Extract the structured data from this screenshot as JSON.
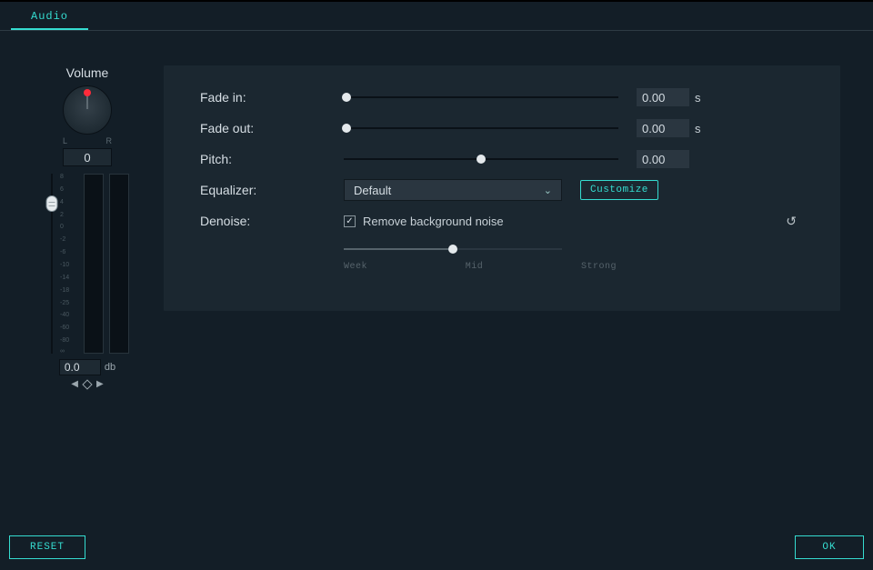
{
  "tab": {
    "audio": "Audio"
  },
  "volume": {
    "title": "Volume",
    "left": "L",
    "right": "R",
    "pan": "0",
    "db_value": "0.0",
    "db_unit": "db",
    "scale": [
      "8",
      "6",
      "4",
      "2",
      "0",
      "-2",
      "-6",
      "-10",
      "-14",
      "-18",
      "-25",
      "-40",
      "-60",
      "-80",
      "∞"
    ]
  },
  "controls": {
    "fade_in": {
      "label": "Fade in:",
      "value": "0.00",
      "unit": "s"
    },
    "fade_out": {
      "label": "Fade out:",
      "value": "0.00",
      "unit": "s"
    },
    "pitch": {
      "label": "Pitch:",
      "value": "0.00"
    },
    "equalizer": {
      "label": "Equalizer:",
      "selected": "Default",
      "customize": "Customize"
    },
    "denoise": {
      "label": "Denoise:",
      "checkbox": "Remove background noise",
      "weak": "Week",
      "mid": "Mid",
      "strong": "Strong"
    }
  },
  "buttons": {
    "reset": "RESET",
    "ok": "OK"
  }
}
